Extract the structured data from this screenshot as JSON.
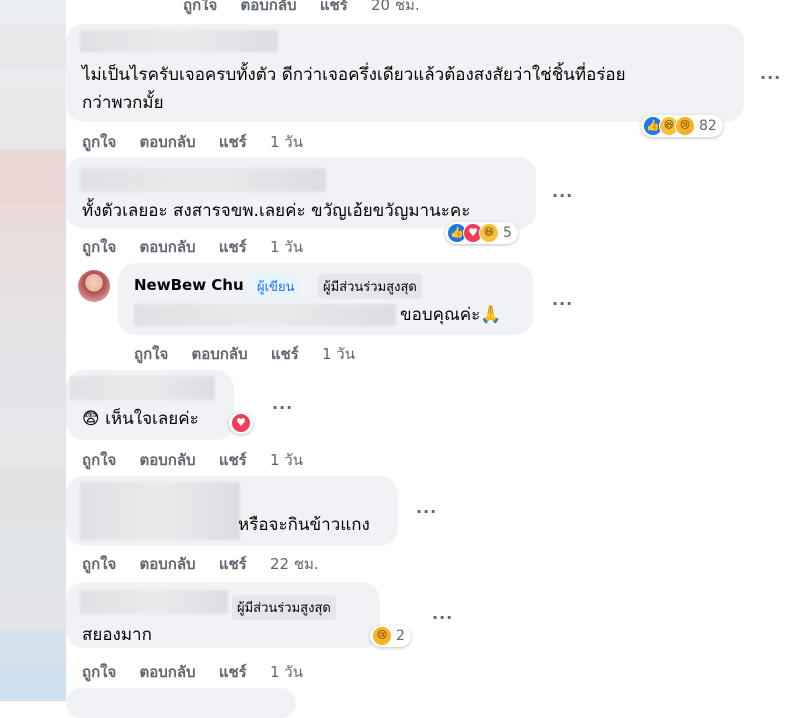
{
  "actions": {
    "like": "ถูกใจ",
    "reply": "ตอบกลับ",
    "share": "แชร์"
  },
  "top": {
    "time": "20 ชม."
  },
  "comments": [
    {
      "text_line1": "ไม่เป็นไรครับเจอครบทั้งตัว ดีกว่าเจอครึ่งเดียวแล้วต้องสงสัยว่าใช่ชิ้นที่อร่อย",
      "text_line2": "กว่าพวกมั้ย",
      "reactions": [
        "like",
        "haha",
        "sad"
      ],
      "reaction_count": "82",
      "time": "1 วัน"
    },
    {
      "text": "ทั้งตัวเลยอะ สงสารจขพ.เลยค่ะ ขวัญเอ้ยขวัญมานะคะ",
      "reactions": [
        "like",
        "love",
        "haha"
      ],
      "reaction_count": "5",
      "time": "1 วัน"
    },
    {
      "author": "NewBew Chu",
      "badge_author": "ผู้เขียน",
      "badge_top": "ผู้มีส่วนร่วมสูงสุด",
      "text": "ขอบคุณค่ะ🙏",
      "time": "1 วัน"
    },
    {
      "text": "😨 เห็นใจเลยค่ะ",
      "time": "1 วัน"
    },
    {
      "text": "หรือจะกินข้าวแกง",
      "time": "22 ชม."
    },
    {
      "badge_top": "ผู้มีส่วนร่วมสูงสุด",
      "text": "สยองมาก",
      "reactions": [
        "sad"
      ],
      "reaction_count": "2",
      "time": "1 วัน"
    }
  ],
  "more_label": "···",
  "icons": {
    "like": "like-icon",
    "haha": "haha-icon",
    "sad": "sad-icon",
    "love": "love-icon"
  },
  "colors": {
    "link_blue": "#1877f2",
    "bubble": "#f0f2f5",
    "meta": "#65676b"
  }
}
